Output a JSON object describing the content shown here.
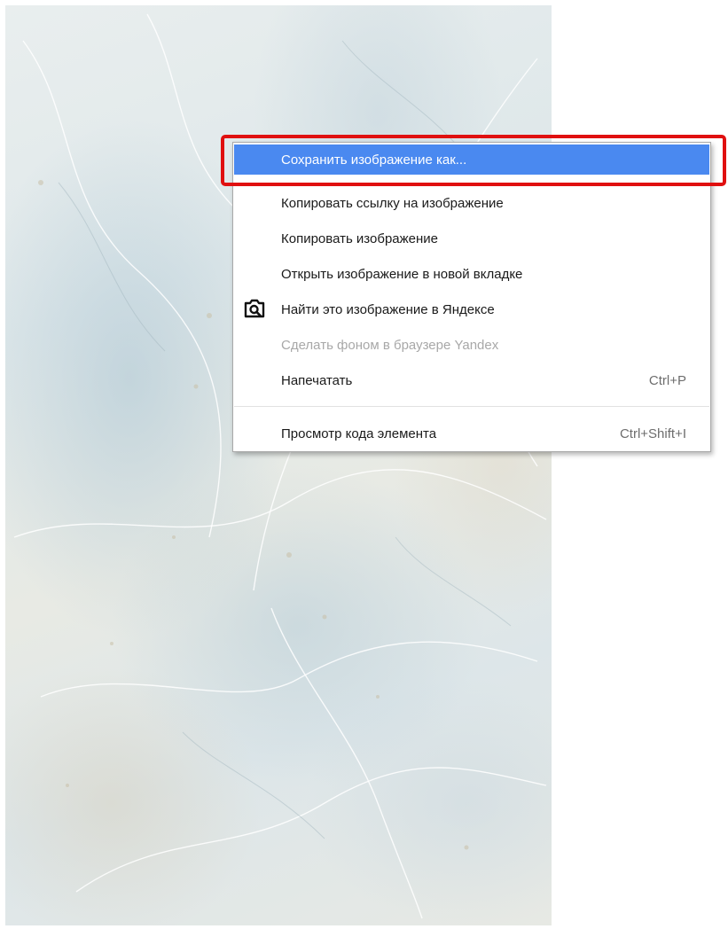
{
  "context_menu": {
    "items": [
      {
        "label": "Сохранить изображение как...",
        "shortcut": "",
        "state": "highlighted"
      },
      {
        "label": "Копировать ссылку на изображение",
        "shortcut": "",
        "state": "normal"
      },
      {
        "label": "Копировать изображение",
        "shortcut": "",
        "state": "normal"
      },
      {
        "label": "Открыть изображение в новой вкладке",
        "shortcut": "",
        "state": "normal"
      },
      {
        "label": "Найти это изображение в Яндексе",
        "shortcut": "",
        "state": "normal",
        "icon": "camera-search-icon"
      },
      {
        "label": "Сделать фоном в браузере Yandex",
        "shortcut": "",
        "state": "disabled"
      },
      {
        "label": "Напечатать",
        "shortcut": "Ctrl+P",
        "state": "normal"
      },
      {
        "label": "Просмотр кода элемента",
        "shortcut": "Ctrl+Shift+I",
        "state": "normal"
      }
    ]
  },
  "colors": {
    "highlight_background": "#4a89f0",
    "annotation_border": "#e01010",
    "disabled_text": "#a8a8a8"
  }
}
